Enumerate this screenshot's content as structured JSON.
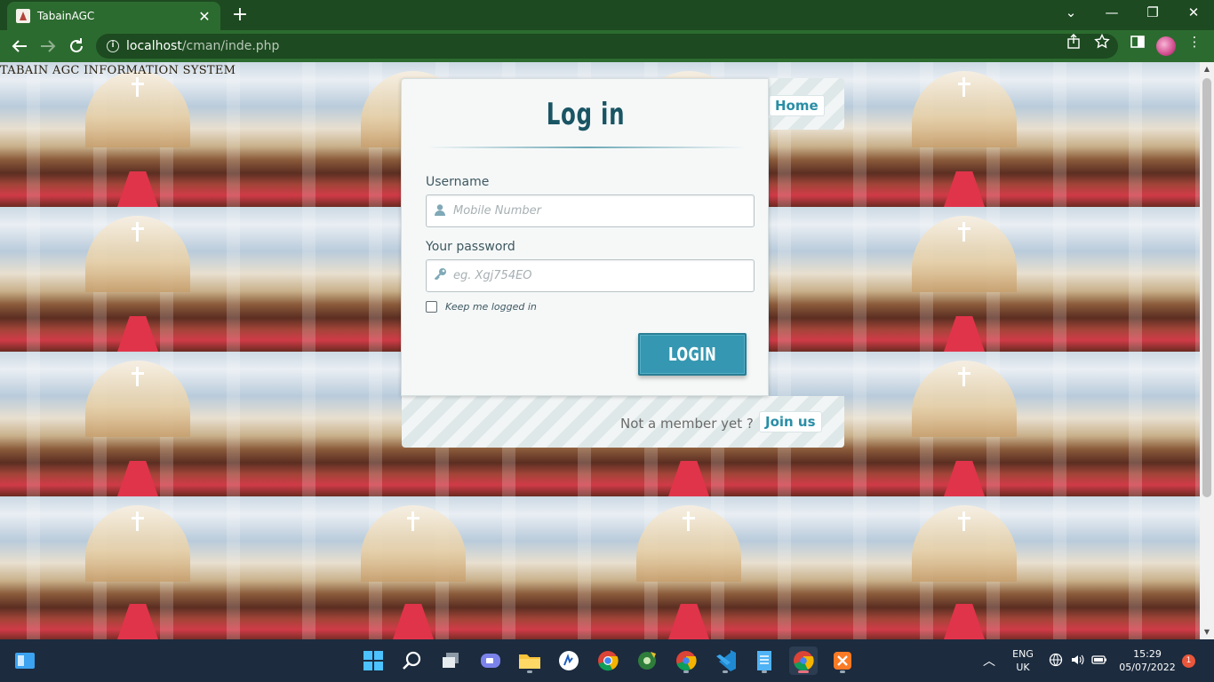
{
  "browser": {
    "tab_title": "TabainAGC",
    "tab_close": "✕",
    "new_tab": "+",
    "url_host": "localhost",
    "url_path": "/cman/inde.php",
    "window_controls": [
      "⌄",
      "—",
      "❐",
      "✕"
    ]
  },
  "page": {
    "site_heading": "TABAIN AGC INFORMATION SYSTEM",
    "login": {
      "title": "Log in",
      "username_label": "Username",
      "username_placeholder": "Mobile Number",
      "password_label": "Your password",
      "password_placeholder": "eg. Xgj754EO",
      "remember_label": "Keep me logged in",
      "remember_checked": false,
      "submit_label": "LOGIN"
    },
    "nav": {
      "home_label": "Home",
      "not_member_text": "Not a member yet ?",
      "join_label": "Join us"
    }
  },
  "taskbar": {
    "language": "ENG",
    "region": "UK",
    "time": "15:29",
    "date": "05/07/2022",
    "notification_count": "1"
  },
  "colors": {
    "accent": "#3597b1",
    "title": "#1a5564",
    "browser_frame": "#2c6b2f"
  }
}
